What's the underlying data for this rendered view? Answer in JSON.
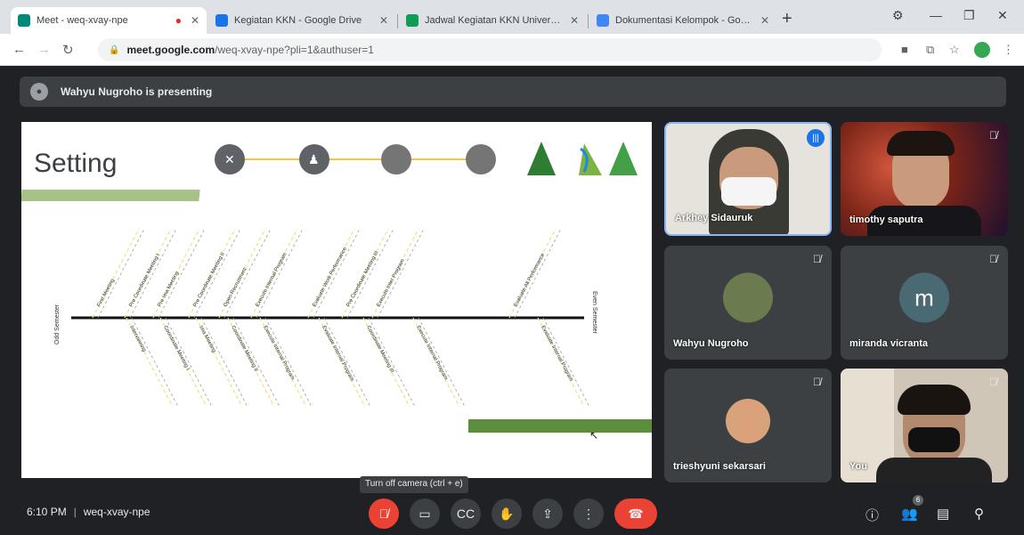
{
  "browser": {
    "tabs": [
      {
        "title": "Meet - weq-xvay-npe",
        "active": true,
        "recording": true
      },
      {
        "title": "Kegiatan KKN - Google Drive"
      },
      {
        "title": "Jadwal Kegiatan KKN Universitas - Goo"
      },
      {
        "title": "Dokumentasi Kelompok - Google"
      }
    ],
    "address": {
      "domain": "meet.google.com",
      "path": "/weq-xvay-npe?pli=1&authuser=1"
    }
  },
  "banner": {
    "text": "Wahyu Nugroho is presenting"
  },
  "slide": {
    "title": "Setting",
    "left_label": "Odd Semester",
    "right_label": "Even Semester",
    "top_items": [
      "First Meeting",
      "Pre Coordinate Meeting I",
      "Pre Ima Meeting",
      "Pre Coordinate Meeting II",
      "Open Recruitment",
      "Execute Internal Program",
      "Evaluate Work Performance",
      "Pre Coordinate Meeting III",
      "Execute Inter Program",
      "Evaluate All Performance"
    ],
    "bottom_items": [
      "Interviewing",
      "Coordinate Meeting I",
      "Ima Meeting",
      "Coordinate Meeting II",
      "Execute Internal Program",
      "Evaluate Internal Program",
      "Coordinate Meeting III",
      "Execute Internal Program",
      "Evaluate Internal Program"
    ]
  },
  "participants": [
    {
      "name": "Arkhey Sidauruk",
      "speaking": true
    },
    {
      "name": "timothy saputra",
      "muted": true
    },
    {
      "name": "Wahyu Nugroho",
      "muted": true
    },
    {
      "name": "miranda vicranta",
      "initial": "m",
      "muted": true
    },
    {
      "name": "trieshyuni sekarsari",
      "muted": true
    },
    {
      "name": "You",
      "muted": true
    }
  ],
  "bottom": {
    "time": "6:10 PM",
    "meeting_code": "weq-xvay-npe",
    "tooltip": "Turn off camera (ctrl + e)",
    "participant_count": "6"
  },
  "colors": {
    "accent": "#1a73e8",
    "danger": "#ea4335",
    "surface": "#3c4043"
  }
}
